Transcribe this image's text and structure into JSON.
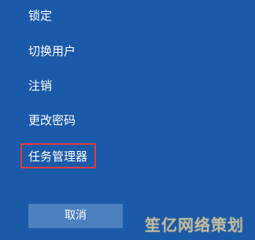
{
  "menu": {
    "items": [
      {
        "label": "锁定"
      },
      {
        "label": "切换用户"
      },
      {
        "label": "注销"
      },
      {
        "label": "更改密码"
      },
      {
        "label": "任务管理器"
      }
    ]
  },
  "buttons": {
    "cancel_label": "取消"
  },
  "watermark": {
    "text": "笙亿网络策划"
  },
  "colors": {
    "background": "#1B5AA8",
    "button": "#4C80BF",
    "highlight": "#E23B3B"
  }
}
